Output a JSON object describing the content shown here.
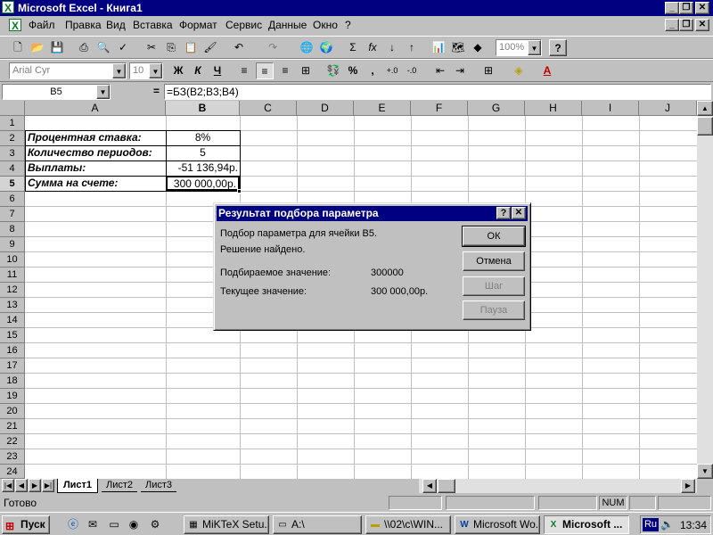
{
  "window": {
    "title": "Microsoft Excel - Книга1"
  },
  "menu": [
    "Файл",
    "Правка",
    "Вид",
    "Вставка",
    "Формат",
    "Сервис",
    "Данные",
    "Окно",
    "?"
  ],
  "toolbar": {
    "zoom": "100%"
  },
  "format_toolbar": {
    "font": "Arial Cyr",
    "size": "10",
    "bold": "Ж",
    "italic": "К",
    "underline": "Ч",
    "percent": "%",
    "comma": ","
  },
  "formula_bar": {
    "name_box": "B5",
    "equals": "=",
    "formula": "=БЗ(B2;B3;B4)"
  },
  "sheet": {
    "columns": [
      "A",
      "B",
      "C",
      "D",
      "E",
      "F",
      "G",
      "H",
      "I",
      "J"
    ],
    "rows": [
      "1",
      "2",
      "3",
      "4",
      "5",
      "6",
      "7",
      "8",
      "9",
      "10",
      "11",
      "12",
      "13",
      "14",
      "15",
      "16",
      "17",
      "18",
      "19",
      "20",
      "21",
      "22",
      "23",
      "24"
    ],
    "cells": {
      "A2": "Процентная ставка:",
      "B2": "8%",
      "A3": "Количество периодов:",
      "B3": "5",
      "A4": "Выплаты:",
      "B4": "-51 136,94р.",
      "A5": "Сумма на счете:",
      "B5": "300 000,00р."
    }
  },
  "dialog": {
    "title": "Результат подбора параметра",
    "line1": "Подбор параметра для ячейки B5.",
    "line2": "Решение найдено.",
    "target_label": "Подбираемое значение:",
    "target_value": "300000",
    "current_label": "Текущее значение:",
    "current_value": "300 000,00р.",
    "ok": "ОК",
    "cancel": "Отмена",
    "step": "Шаг",
    "pause": "Пауза",
    "help": "?",
    "close": "✕"
  },
  "tabs": [
    "Лист1",
    "Лист2",
    "Лист3"
  ],
  "status": {
    "text": "Готово",
    "num": "NUM"
  },
  "taskbar": {
    "start": "Пуск",
    "tasks": [
      "MiKTeX Setu...",
      "A:\\",
      "\\\\02\\c\\WIN...",
      "Microsoft Wo...",
      "Microsoft ..."
    ],
    "lang": "Ru",
    "clock": "13:34"
  }
}
